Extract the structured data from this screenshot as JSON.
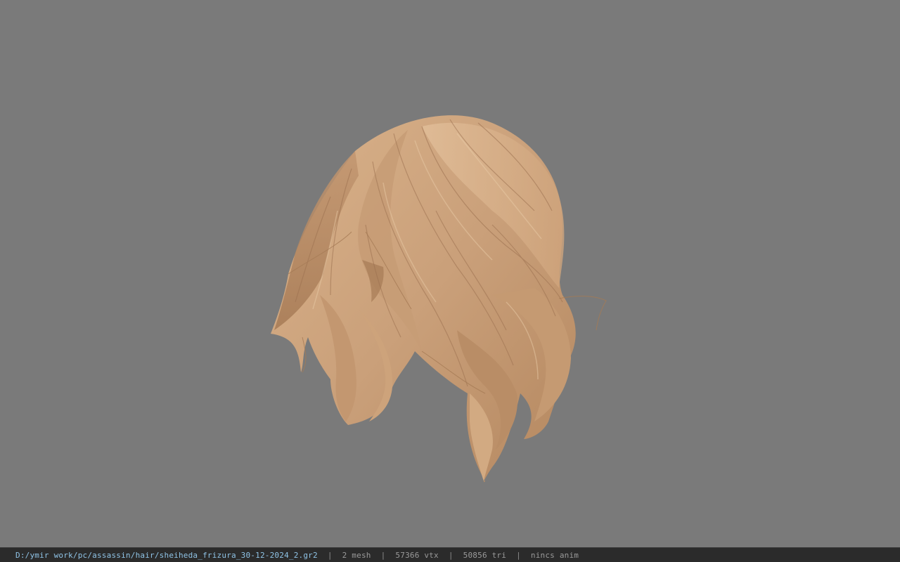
{
  "viewport": {
    "background_color": "#7a7a7a",
    "model_name": "hair-mesh"
  },
  "status_bar": {
    "file_path": "D:/ymir work/pc/assassin/hair/sheiheda_frizura_30-12-2024_2.gr2",
    "separator": "|",
    "mesh_count": "2 mesh",
    "vertex_count": "57366 vtx",
    "triangle_count": "50856 tri",
    "animation_status": "nincs anim",
    "path_color": "#8fc3e6",
    "text_color": "#9a9a9a"
  }
}
